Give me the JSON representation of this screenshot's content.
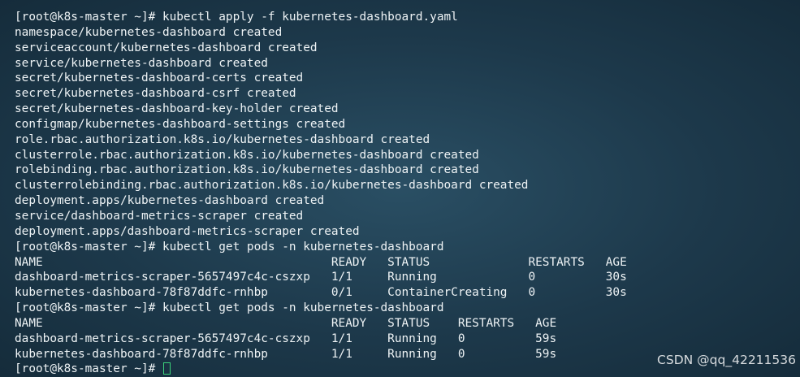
{
  "terminal": {
    "lines": [
      "[root@k8s-master ~]# kubectl apply -f kubernetes-dashboard.yaml",
      "namespace/kubernetes-dashboard created",
      "serviceaccount/kubernetes-dashboard created",
      "service/kubernetes-dashboard created",
      "secret/kubernetes-dashboard-certs created",
      "secret/kubernetes-dashboard-csrf created",
      "secret/kubernetes-dashboard-key-holder created",
      "configmap/kubernetes-dashboard-settings created",
      "role.rbac.authorization.k8s.io/kubernetes-dashboard created",
      "clusterrole.rbac.authorization.k8s.io/kubernetes-dashboard created",
      "rolebinding.rbac.authorization.k8s.io/kubernetes-dashboard created",
      "clusterrolebinding.rbac.authorization.k8s.io/kubernetes-dashboard created",
      "deployment.apps/kubernetes-dashboard created",
      "service/dashboard-metrics-scraper created",
      "deployment.apps/dashboard-metrics-scraper created",
      "[root@k8s-master ~]# kubectl get pods -n kubernetes-dashboard",
      "NAME                                         READY   STATUS              RESTARTS   AGE",
      "dashboard-metrics-scraper-5657497c4c-cszxp   1/1     Running             0          30s",
      "kubernetes-dashboard-78f87ddfc-rnhbp         0/1     ContainerCreating   0          30s",
      "[root@k8s-master ~]# kubectl get pods -n kubernetes-dashboard",
      "NAME                                         READY   STATUS    RESTARTS   AGE",
      "dashboard-metrics-scraper-5657497c4c-cszxp   1/1     Running   0          59s",
      "kubernetes-dashboard-78f87ddfc-rnhbp         1/1     Running   0          59s"
    ],
    "prompt": "[root@k8s-master ~]# ",
    "cursor_color": "#3bd17a"
  },
  "watermark": "CSDN @qq_42211536"
}
